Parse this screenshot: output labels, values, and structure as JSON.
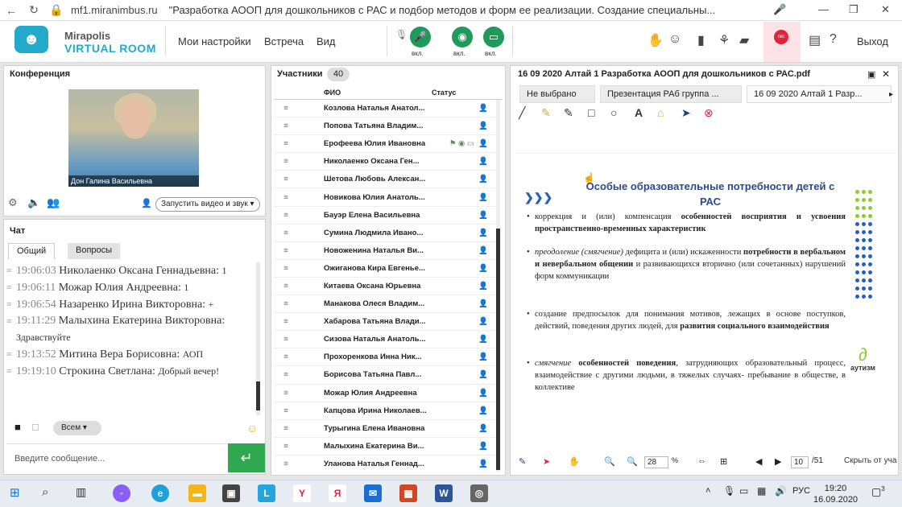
{
  "browser": {
    "host": "mf1.miranimbus.ru",
    "title": "\"Разработка АООП для дошкольников с РАС и подбор методов и форм ее реализации. Создание специальны..."
  },
  "header": {
    "logo_top": "Mirapolis",
    "logo_bottom": "VIRTUAL ROOM",
    "menu": [
      "Мои настройки",
      "Встреча",
      "Вид"
    ],
    "media": [
      {
        "label": "вкл."
      },
      {
        "label": "вкл."
      },
      {
        "label": "вкл."
      }
    ],
    "rec_label": "rec",
    "exit": "Выход"
  },
  "conference": {
    "title": "Конференция",
    "video_name": "Дон Галина  Васильевна",
    "start_video": "Запустить видео и звук"
  },
  "chat": {
    "title": "Чат",
    "tabs": [
      "Общий",
      "Вопросы"
    ],
    "messages": [
      {
        "time": "19:06:03",
        "author": "Николаенко  Оксана Геннадьевна:",
        "text": "1"
      },
      {
        "time": "19:06:11",
        "author": "Можар  Юлия  Андреевна:",
        "text": "1"
      },
      {
        "time": "19:06:54",
        "author": "Назаренко  Ирина   Викторовна:",
        "text": "+"
      },
      {
        "time": "19:11:29",
        "author": "Малыхина  Екатерина Викторовна:",
        "text": "Здравствуйте"
      },
      {
        "time": "19:13:52",
        "author": "Митина Вера  Борисовна:",
        "text": "АОП"
      },
      {
        "time": "19:19:10",
        "author": "Строкина  Светлана:",
        "text": "Добрый вечер!"
      }
    ],
    "recipient": "Всем",
    "input_placeholder": "Введите сообщение..."
  },
  "participants": {
    "title": "Участники",
    "count": "40",
    "col_name": "ФИО",
    "col_status": "Статус",
    "rows": [
      "Козлова Наталья  Анатол...",
      "Попова Татьяна  Владим...",
      "Ерофеева Юлия  Ивановна",
      "Николаенко  Оксана  Ген...",
      "Шетова Любовь  Алексан...",
      "Новикова Юлия   Анатоль...",
      "Бауэр Елена  Васильевна",
      "Сумина Людмила  Ивано...",
      "Новоженина Наталья  Ви...",
      "Ожиганова  Кира Евгенье...",
      "Китаева Оксана  Юрьевна",
      "Манакова Олеся  Владим...",
      "Хабарова Татьяна  Влади...",
      "Сизова Наталья Анатоль...",
      "Прохоренкова Инна  Ник...",
      "Борисова  Татьяна   Павл...",
      "Можар  Юлия Андреевна",
      "Капцова Ирина Николаев...",
      "Турыгина  Елена Ивановна",
      "Малыхина  Екатерина Ви...",
      "Уланова  Наталья Геннад..."
    ]
  },
  "document": {
    "title": "16 09 2020 Алтай  1 Разработка АООП для дошкольников с РАС.pdf",
    "tabs": [
      "Не выбрано",
      "Презентация РАб группа ...",
      "16 09 2020 Алтай  1 Разр..."
    ],
    "slide": {
      "title": "Особые образовательные потребности детей с  РАС",
      "bullets": [
        "коррекция и (или) компенсация особенностей восприятия и усвоения пространственно-временных характеристик",
        "преодоление (смягчение) дефицита и (или) искаженности потребности в вербальном и невербальном общении и развивающихся вторично (или сочетанных) нарушений форм коммуникации",
        "создание предпосылок для понимания мотивов, лежащих в основе поступков, действий, поведения других людей, для развития социального взаимодействия",
        "смягчение  особенностей  поведения, затрудняющих образовательный процесс, взаимодействие с другими людьми, в тяжелых случаях- пребывание в обществе, в коллективе"
      ],
      "logo": "аутизм"
    },
    "zoom": "28",
    "zoom_unit": "%",
    "page": "10",
    "pages": "/51",
    "hide": "Скрыть от уча"
  },
  "taskbar": {
    "lang": "РУС",
    "time": "19:20",
    "date": "16.09.2020",
    "notif": "3"
  }
}
